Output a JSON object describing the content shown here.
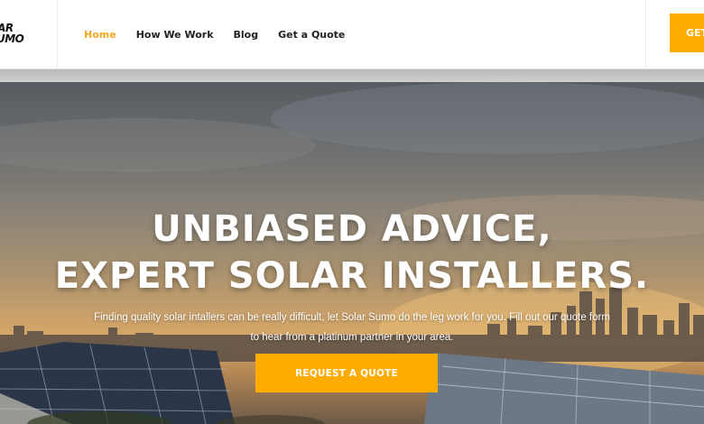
{
  "brand": {
    "logo_line1": "LAR",
    "logo_line2": "UMO"
  },
  "nav": {
    "items": [
      {
        "label": "Home",
        "active": true
      },
      {
        "label": "How We Work",
        "active": false
      },
      {
        "label": "Blog",
        "active": false
      },
      {
        "label": "Get a Quote",
        "active": false
      }
    ],
    "cta_label": "GET"
  },
  "hero": {
    "title_line1": "UNBIASED ADVICE,",
    "title_line2": "EXPERT SOLAR INSTALLERS.",
    "subtitle_line1": "Finding quality solar intallers can be really difficult, let Solar Sumo do the leg work for you. Fill out our quote form",
    "subtitle_line2": "to hear from a platinum partner in your area.",
    "button_label": "REQUEST A QUOTE"
  },
  "colors": {
    "accent": "#ffab00",
    "nav_active": "#f5a623",
    "text_dark": "#222222"
  }
}
